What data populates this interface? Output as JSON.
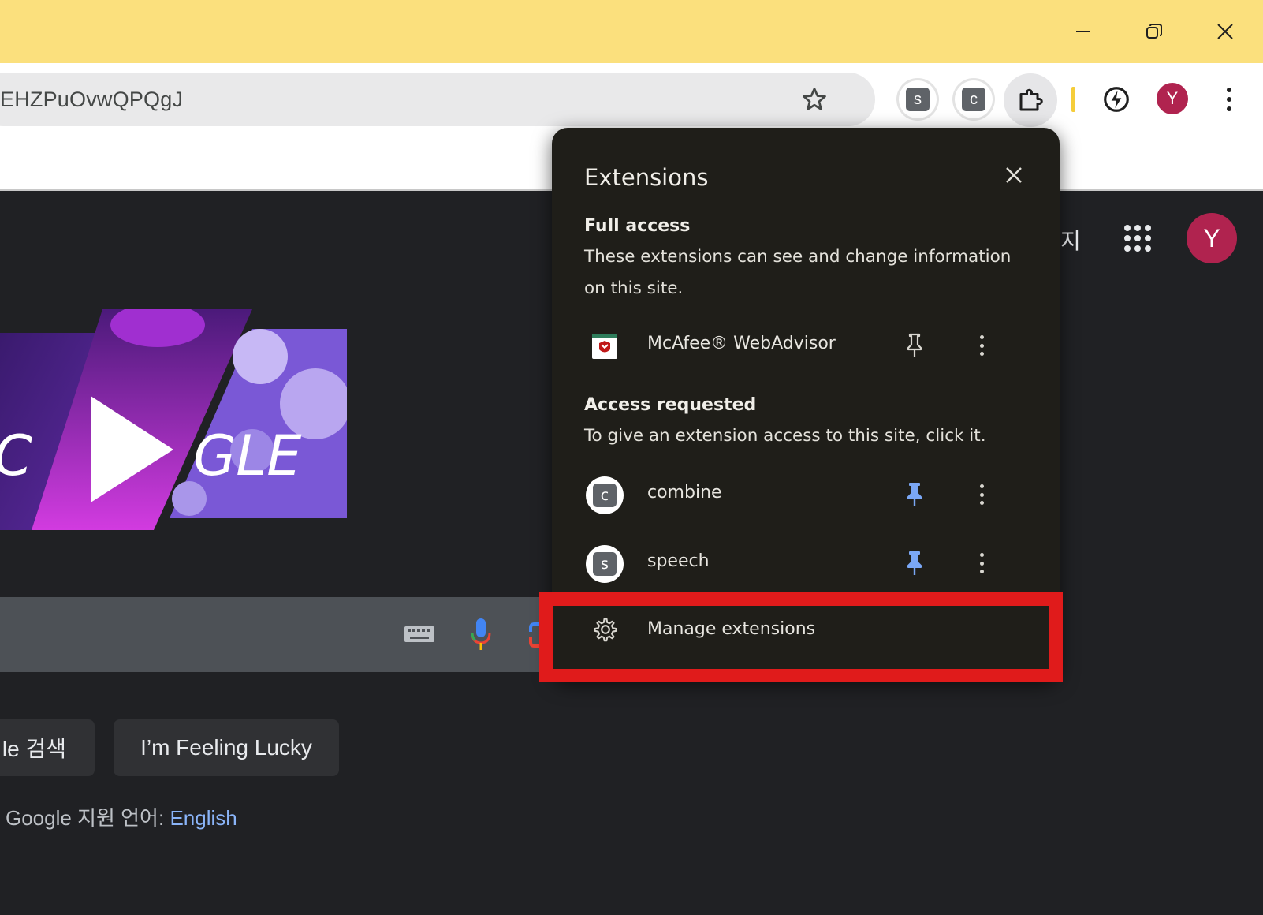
{
  "window": {
    "controls": [
      "minimize-icon",
      "restore-icon",
      "close-icon"
    ]
  },
  "toolbar": {
    "url_fragment": "EHZPuOvwQPQgJ",
    "pinned_extensions": [
      {
        "letter": "s"
      },
      {
        "letter": "c"
      }
    ],
    "profile_initial": "Y"
  },
  "page": {
    "top_link": "지",
    "profile_initial": "Y",
    "search_button": "le 검색",
    "lucky_button": "I’m Feeling Lucky",
    "lang_prefix": "Google 지원 언어:",
    "lang_link": "English"
  },
  "popup": {
    "title": "Extensions",
    "full_access": {
      "heading": "Full access",
      "description": "These extensions can see and change information on this site.",
      "items": [
        {
          "name": "McAfee® WebAdvisor",
          "pinned": false
        }
      ]
    },
    "access_requested": {
      "heading": "Access requested",
      "description": "To give an extension access to this site, click it.",
      "items": [
        {
          "name": "combine",
          "letter": "c",
          "pinned": true
        },
        {
          "name": "speech",
          "letter": "s",
          "pinned": true
        }
      ]
    },
    "manage_label": "Manage extensions"
  },
  "colors": {
    "titlebar": "#fbe07d",
    "popup_bg": "#1f1e19",
    "pin_blue": "#7aa7f5",
    "highlight": "#e01b1b",
    "avatar": "#b0234f"
  }
}
